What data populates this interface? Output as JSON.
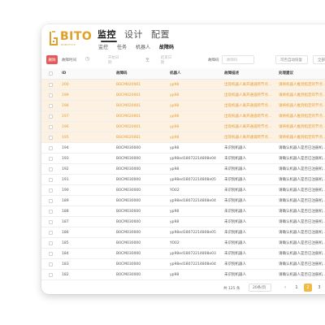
{
  "brand": {
    "name": "BITO",
    "sub": "ROBOTICS",
    "color": "#e0a027"
  },
  "main_nav": [
    "监控",
    "设计",
    "配置"
  ],
  "sub_nav": [
    "监控",
    "任务",
    "机器人",
    "故障码"
  ],
  "toolbar": {
    "delete_label": "删除",
    "time_label": "故障时间",
    "start_placeholder": "开始日期",
    "range_sep": "至",
    "end_placeholder": "结束日期",
    "code_label": "故障码",
    "code_placeholder": "故障码",
    "recover_placeholder": "可否自动恢复",
    "all_label": "全部"
  },
  "columns": [
    "",
    "ID",
    "故障码",
    "机器人",
    "故障描述",
    "处理建议"
  ],
  "colors": {
    "highlight_bg": "#fdf2e2",
    "highlight_text": "#e39a35",
    "accent": "#f2b945",
    "delete": "#e45a5a"
  },
  "rows": [
    {
      "id": "200",
      "code": "B0CM020001",
      "robot": "yp98",
      "desc": "出现机器人离开通道跨节点…",
      "advice": "请将机器人推到指定的节点…",
      "hl": true
    },
    {
      "id": "199",
      "code": "B0CM020001",
      "robot": "yp98",
      "desc": "出现机器人离开通道跨节点…",
      "advice": "请将机器人推到指定的节点…",
      "hl": true
    },
    {
      "id": "198",
      "code": "B0CM020001",
      "robot": "yp98",
      "desc": "出现机器人离开通道跨节点…",
      "advice": "请将机器人推到指定的节点…",
      "hl": true
    },
    {
      "id": "197",
      "code": "B0CM020001",
      "robot": "yp98",
      "desc": "出现机器人离开通道跨节点…",
      "advice": "请将机器人推到指定的节点…",
      "hl": true
    },
    {
      "id": "196",
      "code": "B0CM020001",
      "robot": "yp98",
      "desc": "出现机器人离开通道跨节点…",
      "advice": "请将机器人推到指定的节点…",
      "hl": true
    },
    {
      "id": "195",
      "code": "B0CM020001",
      "robot": "yp98",
      "desc": "出现机器人离开通道跨节点…",
      "advice": "请将机器人推到指定的节点…",
      "hl": true
    },
    {
      "id": "194",
      "code": "B0CM030000",
      "robot": "yp98",
      "desc": "未识别机器人",
      "advice": "请确认机器人是否已注册机…",
      "hl": false
    },
    {
      "id": "193",
      "code": "B0CM030000",
      "robot": "yp98ed18072214808e04",
      "desc": "未识别机器人",
      "advice": "请确认机器人是否已注册机…",
      "hl": false
    },
    {
      "id": "192",
      "code": "B0CM030000",
      "robot": "yp98",
      "desc": "未识别机器人",
      "advice": "请确认机器人是否已注册机…",
      "hl": false
    },
    {
      "id": "191",
      "code": "B0CM030000",
      "robot": "yp98ed18072214808e05",
      "desc": "未识别机器人",
      "advice": "请确认机器人是否已注册机…",
      "hl": false
    },
    {
      "id": "190",
      "code": "B0CM030000",
      "robot": "YO02",
      "desc": "未识别机器人",
      "advice": "请确认机器人是否已注册机…",
      "hl": false
    },
    {
      "id": "189",
      "code": "B0CM030000",
      "robot": "yp98ed18072214808e04",
      "desc": "未识别机器人",
      "advice": "请确认机器人是否已注册机…",
      "hl": false
    },
    {
      "id": "188",
      "code": "B0CM030000",
      "robot": "yp98",
      "desc": "未识别机器人",
      "advice": "请确认机器人是否已注册机…",
      "hl": false
    },
    {
      "id": "187",
      "code": "B0CM030000",
      "robot": "yp98",
      "desc": "未识别机器人",
      "advice": "请确认机器人是否已注册机…",
      "hl": false
    },
    {
      "id": "186",
      "code": "B0CM030000",
      "robot": "yp98ed18072214808e05",
      "desc": "未识别机器人",
      "advice": "请确认机器人是否已注册机…",
      "hl": false
    },
    {
      "id": "185",
      "code": "B0CM030000",
      "robot": "YO02",
      "desc": "未识别机器人",
      "advice": "请确认机器人是否已注册机…",
      "hl": false
    },
    {
      "id": "184",
      "code": "B0CM030000",
      "robot": "yp98ed18072214808e03",
      "desc": "未识别机器人",
      "advice": "请确认机器人是否已注册机…",
      "hl": false
    },
    {
      "id": "183",
      "code": "B0CM030000",
      "robot": "yp98ed18072214808e04",
      "desc": "未识别机器人",
      "advice": "请确认机器人是否已注册机…",
      "hl": false
    },
    {
      "id": "182",
      "code": "B0CM030000",
      "robot": "yp98",
      "desc": "未识别机器人",
      "advice": "请确认机器人是否已注册机…",
      "hl": false
    }
  ],
  "footer": {
    "total": "共 125 条",
    "page_size": "20条/页",
    "prev": "‹",
    "pages": [
      "1",
      "2",
      "3"
    ],
    "current_page": "2"
  }
}
